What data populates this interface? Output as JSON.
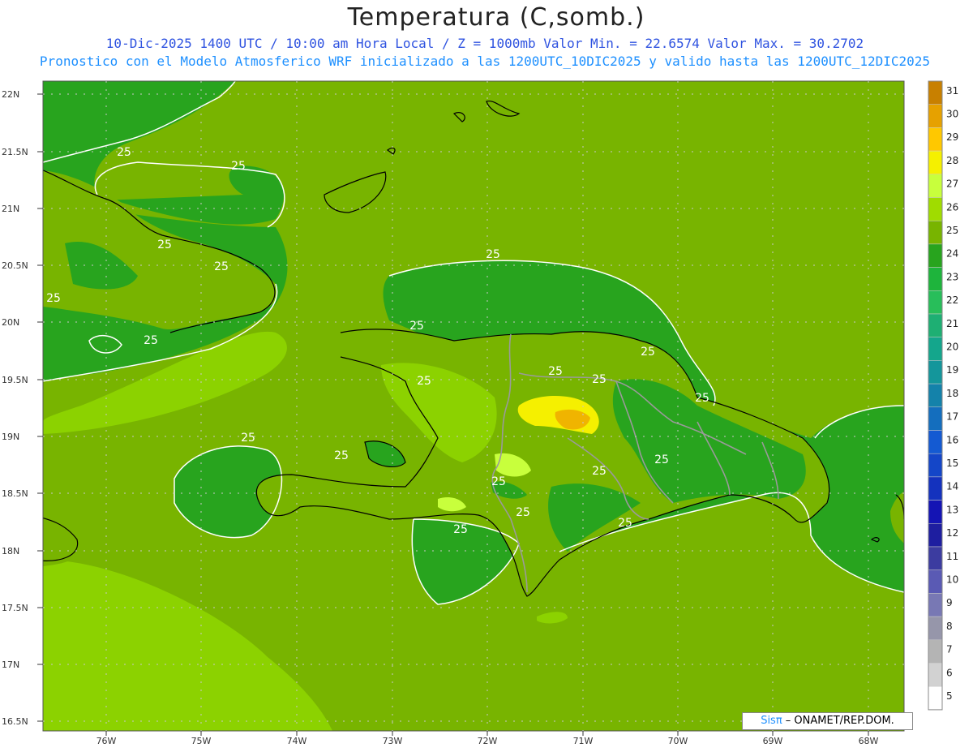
{
  "title": "Temperatura (C,somb.)",
  "subtitle1": "10-Dic-2025 1400 UTC / 10:00 am Hora Local / Z = 1000mb   Valor Min. = 22.6574  Valor Max. = 30.2702",
  "subtitle2": "Pronostico con el Modelo Atmosferico WRF inicializado a las 1200UTC_10DIC2025 y valido hasta las  1200UTC_12DIC2025",
  "credit": {
    "brand": "Sisπ",
    "text": " – ONAMET/REP.DOM."
  },
  "lat_labels": [
    "22N",
    "21.5N",
    "21N",
    "20.5N",
    "20N",
    "19.5N",
    "19N",
    "18.5N",
    "18N",
    "17.5N",
    "17N",
    "16.5N"
  ],
  "lon_labels": [
    "76W",
    "75W",
    "74W",
    "73W",
    "72W",
    "71W",
    "70W",
    "69W",
    "68W"
  ],
  "contour_labels": [
    "25",
    "25",
    "25",
    "25",
    "25",
    "25",
    "25",
    "25",
    "25",
    "25",
    "25",
    "25",
    "25",
    "25",
    "25",
    "25",
    "25",
    "25",
    "25",
    "25",
    "25"
  ],
  "legend": {
    "levels": [
      "31",
      "30",
      "29",
      "28",
      "27",
      "26",
      "25",
      "24",
      "23",
      "22",
      "21",
      "20",
      "19",
      "18",
      "17",
      "16",
      "15",
      "14",
      "13",
      "12",
      "11",
      "10",
      "9",
      "8",
      "7",
      "6",
      "5"
    ],
    "colors": [
      "#c88000",
      "#e6a100",
      "#ffc800",
      "#f5f000",
      "#c8ff3c",
      "#a0dc00",
      "#78b400",
      "#28a41e",
      "#1eb43c",
      "#28be5a",
      "#1eaf73",
      "#14a68c",
      "#14969b",
      "#1482aa",
      "#146ebe",
      "#145ad2",
      "#1446c8",
      "#1432be",
      "#1414b4",
      "#1e1ea0",
      "#3c3ca0",
      "#5a5ab4",
      "#7878b4",
      "#9696aa",
      "#b4b4b4",
      "#d2d2d2",
      "#ffffff"
    ]
  },
  "colors": {
    "sea_base": "#78b400",
    "warm_sea": "#8cd200",
    "land_green": "#28a41e",
    "hot_yellow": "#f5f000",
    "hot_orange": "#f0b400"
  }
}
